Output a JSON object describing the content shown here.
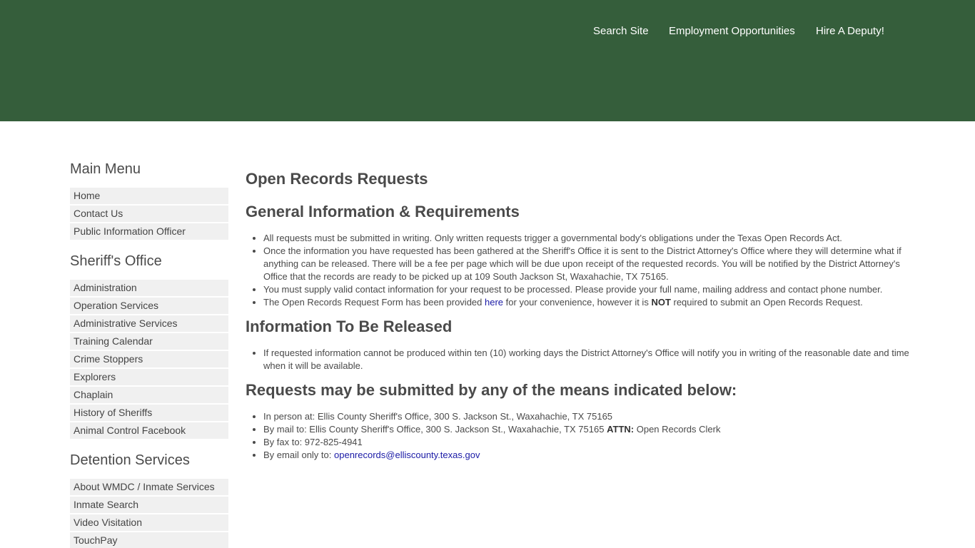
{
  "header": {
    "nav": [
      {
        "label": "Search Site"
      },
      {
        "label": "Employment Opportunities"
      },
      {
        "label": "Hire A Deputy!"
      }
    ],
    "bg_color": "#355e3b"
  },
  "sidebar": {
    "sections": [
      {
        "heading": "Main Menu",
        "items": [
          "Home",
          "Contact Us",
          "Public Information Officer"
        ]
      },
      {
        "heading": "Sheriff's Office",
        "items": [
          "Administration",
          "Operation Services",
          "Administrative Services",
          "Training Calendar",
          "Crime Stoppers",
          "Explorers",
          "Chaplain",
          "History of Sheriffs",
          "Animal Control Facebook"
        ]
      },
      {
        "heading": "Detention Services",
        "items": [
          "About WMDC / Inmate Services",
          "Inmate Search",
          "Video Visitation",
          "TouchPay"
        ]
      }
    ]
  },
  "main": {
    "title": "Open Records Requests",
    "general": {
      "heading": "General Information & Requirements",
      "item1": "All requests must be submitted in writing. Only written requests trigger a governmental body's obligations under the Texas Open Records Act.",
      "item2": "Once the information you have requested has been gathered at the Sheriff's Office it is sent to the District Attorney's Office where they will determine what if anything can be released. There will be a fee per page which will be due upon receipt of the requested records. You will be notified by the District Attorney's Office that the records are ready to be picked up at 109 South Jackson St, Waxahachie, TX 75165.",
      "item3": "You must supply valid contact information for your request to be processed. Please provide your full name, mailing address and contact phone number.",
      "item4_pre": "The Open Records Request Form has been provided ",
      "item4_link": "here",
      "item4_mid": " for your convenience, however it is ",
      "item4_bold": "NOT",
      "item4_post": " required to submit an Open Records Request."
    },
    "released": {
      "heading": "Information To Be Released",
      "item1": "If requested information cannot be produced within ten (10) working days the District Attorney's Office will notify you in writing of the reasonable date and time when it will be available."
    },
    "means": {
      "heading": "Requests may be submitted by any of the means indicated below:",
      "in_person": "In person at: Ellis County Sheriff's Office, 300 S. Jackson St., Waxahachie, TX 75165",
      "mail_pre": "By mail to: Ellis County Sheriff's Office, 300 S. Jackson St., Waxahachie, TX 75165 ",
      "mail_bold": "ATTN:",
      "mail_post": " Open Records Clerk",
      "fax": "By fax to: 972-825-4941",
      "email_pre": "By email only to: ",
      "email_link": "openrecords@elliscounty.texas.gov"
    }
  }
}
